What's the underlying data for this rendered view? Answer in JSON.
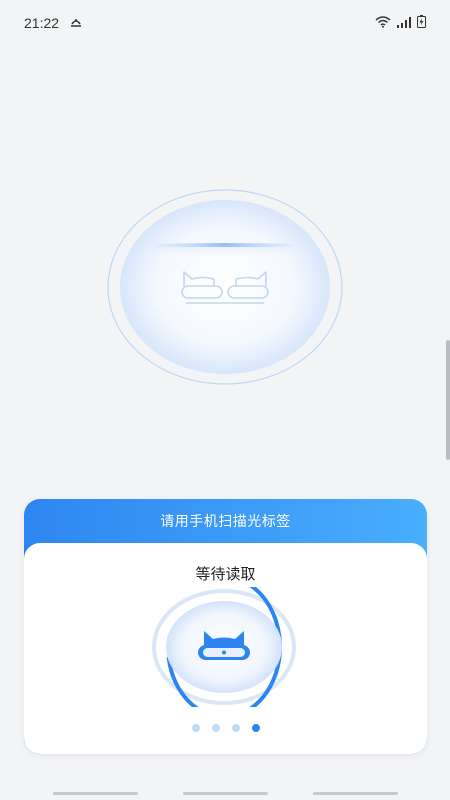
{
  "status_bar": {
    "time": "21:22",
    "icons": [
      "notification-icon",
      "wifi-icon",
      "signal-icon",
      "battery-charging-icon"
    ]
  },
  "scan_card": {
    "title": "请用手机扫描光标签",
    "status": "等待读取",
    "progress": 0.72,
    "pager": {
      "total": 4,
      "active_index": 3
    }
  },
  "colors": {
    "accent": "#2d86f0",
    "accent_light": "#49aefc",
    "background": "#f3f4f6"
  }
}
